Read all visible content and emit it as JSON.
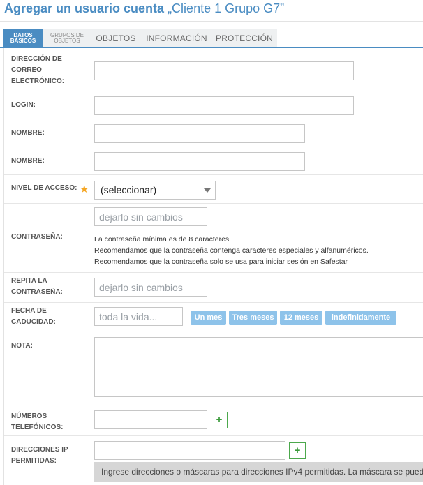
{
  "header": {
    "title": "Agregar un usuario cuenta",
    "client": "„Cliente 1 Grupo G7”"
  },
  "tabs": [
    {
      "label": "DATOS BÁSICOS",
      "active": true
    },
    {
      "label": "GRUPOS DE OBJETOS",
      "active": false
    },
    {
      "label": "OBJETOS",
      "active": false
    },
    {
      "label": "INFORMACIÓN",
      "active": false
    },
    {
      "label": "PROTECCIÓN",
      "active": false
    }
  ],
  "form": {
    "email": {
      "label": "DIRECCIÓN DE CORREO ELECTRÓNICO:",
      "value": ""
    },
    "login": {
      "label": "LOGIN:",
      "value": ""
    },
    "first_name": {
      "label": "NOMBRE:",
      "value": ""
    },
    "last_name": {
      "label": "NOMBRE:",
      "value": ""
    },
    "access_level": {
      "label": "NIVEL DE ACCESO:",
      "required_icon": "★",
      "selected": "(seleccionar)"
    },
    "password": {
      "label": "CONTRASEÑA:",
      "placeholder": "dejarlo sin cambios",
      "hints": [
        "La contraseña mínima es de 8 caracteres",
        "Recomendamos que la contraseña contenga caracteres especiales y alfanuméricos.",
        "Recomendamos que la contraseña solo se usa para iniciar sesión en Safestar"
      ]
    },
    "password_repeat": {
      "label": "REPITA LA CONTRASEÑA:",
      "placeholder": "dejarlo sin cambios"
    },
    "expiry": {
      "label": "FECHA DE CADUCIDAD:",
      "placeholder": "toda la vida...",
      "options": [
        "Un mes",
        "Tres meses",
        "12 meses",
        "indefinidamente"
      ]
    },
    "note": {
      "label": "NOTA:",
      "value": ""
    },
    "phones": {
      "label": "NÚMEROS TELEFÓNICOS:",
      "add_label": "+"
    },
    "ips": {
      "label": "DIRECCIONES IP PERMITIDAS:",
      "add_label": "+",
      "info": "Ingrese direcciones o máscaras para direcciones IPv4 permitidas. La máscara se puede ingresar..."
    }
  },
  "colors": {
    "accent": "#4a8cc2",
    "chip": "#8ec3ea",
    "required": "#f5a623",
    "add": "#4ca84c"
  }
}
